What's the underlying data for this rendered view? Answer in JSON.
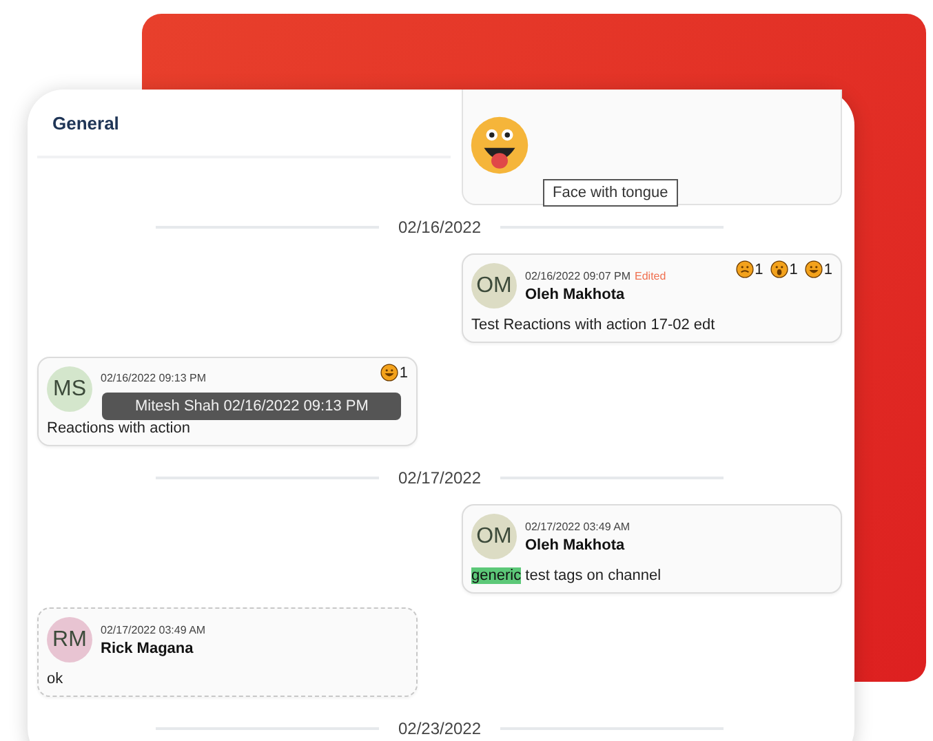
{
  "channel": {
    "title": "General"
  },
  "top_message": {
    "kind": "tongue",
    "tooltip": "Face with tongue"
  },
  "feed": [
    {
      "kind": "date",
      "label": "02/16/2022"
    },
    {
      "kind": "message",
      "outgoing": true,
      "initials": "OM",
      "color": "#dcdcc4",
      "time": "02/16/2022 09:07 PM",
      "edited": "Edited",
      "name": "Oleh Makhota",
      "text": "Test Reactions with action 17-02 edt",
      "reactions": [
        {
          "kind": "frown",
          "count": "1"
        },
        {
          "kind": "scared",
          "count": "1"
        },
        {
          "kind": "grin",
          "count": "1"
        }
      ]
    },
    {
      "kind": "message",
      "outgoing": false,
      "initials": "MS",
      "color": "#d4e6cc",
      "time": "02/16/2022 09:13 PM",
      "tooltip": "Mitesh Shah 02/16/2022 09:13 PM",
      "text": "Reactions with action",
      "reactions": [
        {
          "kind": "grin",
          "count": "1"
        }
      ]
    },
    {
      "kind": "date",
      "label": "02/17/2022"
    },
    {
      "kind": "message",
      "outgoing": true,
      "initials": "OM",
      "color": "#dcdcc4",
      "time": "02/17/2022 03:49 AM",
      "name": "Oleh Makhota",
      "tag": "generic",
      "text": "test tags on channel"
    },
    {
      "kind": "message",
      "outgoing": false,
      "dashed": true,
      "initials": "RM",
      "color": "#e8c4d2",
      "time": "02/17/2022 03:49 AM",
      "name": "Rick Magana",
      "text": "ok"
    },
    {
      "kind": "date",
      "label": "02/23/2022"
    }
  ]
}
